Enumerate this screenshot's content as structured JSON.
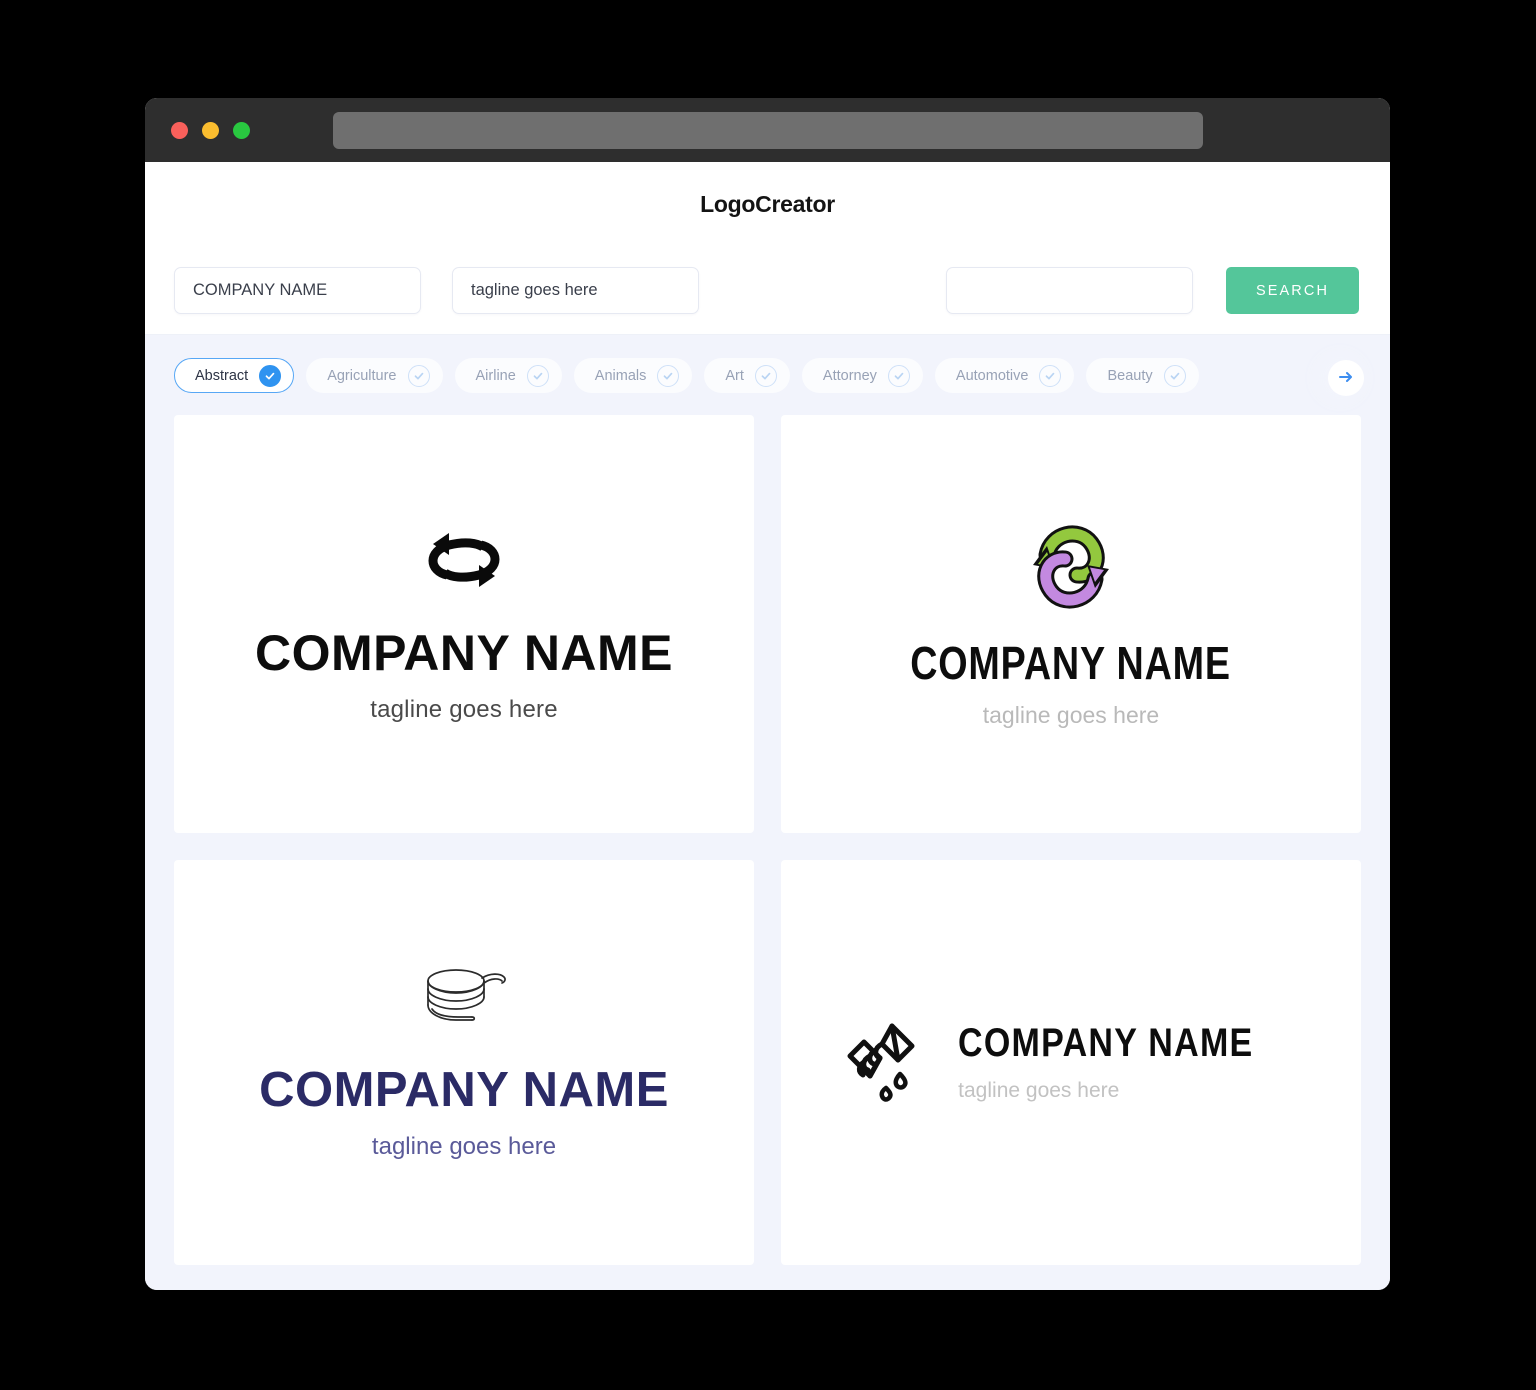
{
  "window": {
    "traffic_lights": [
      {
        "name": "close",
        "color": "#f9605b"
      },
      {
        "name": "minimize",
        "color": "#fabd2f"
      },
      {
        "name": "maximize",
        "color": "#29c840"
      }
    ],
    "url_value": ""
  },
  "header": {
    "brand": "LogoCreator"
  },
  "form": {
    "company_value": "COMPANY NAME",
    "company_placeholder": "COMPANY NAME",
    "tagline_value": "tagline goes here",
    "tagline_placeholder": "tagline goes here",
    "keyword_value": "",
    "keyword_placeholder": "",
    "search_label": "SEARCH",
    "search_color": "#54c69a"
  },
  "categories": {
    "next_icon": "arrow-right-icon",
    "accent_color": "#2f93f0",
    "items": [
      {
        "label": "Abstract",
        "selected": true
      },
      {
        "label": "Agriculture",
        "selected": false
      },
      {
        "label": "Airline",
        "selected": false
      },
      {
        "label": "Animals",
        "selected": false
      },
      {
        "label": "Art",
        "selected": false
      },
      {
        "label": "Attorney",
        "selected": false
      },
      {
        "label": "Automotive",
        "selected": false
      },
      {
        "label": "Beauty",
        "selected": false
      }
    ]
  },
  "results": [
    {
      "id": "logo-1",
      "icon": "sync-arrows-loop-icon",
      "layout": "vertical",
      "name": "COMPANY NAME",
      "tagline": "tagline goes here",
      "name_color": "#0d0d0d",
      "tagline_color": "#4a4a4a"
    },
    {
      "id": "logo-2",
      "icon": "recycle-double-arrow-icon",
      "layout": "vertical",
      "name": "COMPANY NAME",
      "tagline": "tagline goes here",
      "name_color": "#0d0d0d",
      "tagline_color": "#b9b9b9",
      "mark_colors": {
        "green": "#93c83e",
        "purple": "#c389e0",
        "outline": "#111111"
      }
    },
    {
      "id": "logo-3",
      "icon": "coil-spring-icon",
      "layout": "vertical",
      "name": "COMPANY NAME",
      "tagline": "tagline goes here",
      "name_color": "#2b2b66",
      "tagline_color": "#5a5a99"
    },
    {
      "id": "logo-4",
      "icon": "wrung-towel-drops-icon",
      "layout": "horizontal",
      "name": "COMPANY NAME",
      "tagline": "tagline goes here",
      "name_color": "#0d0d0d",
      "tagline_color": "#c2c2c2"
    }
  ]
}
